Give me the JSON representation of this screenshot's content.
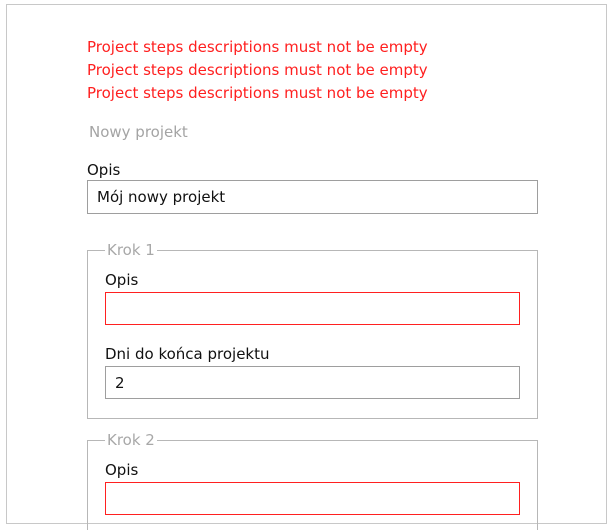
{
  "errors": [
    "Project steps descriptions must not be empty",
    "Project steps descriptions must not be empty",
    "Project steps descriptions must not be empty"
  ],
  "form": {
    "title": "Nowy projekt",
    "description_label": "Opis",
    "description_value": "Mój nowy projekt",
    "steps": [
      {
        "legend": "Krok 1",
        "description_label": "Opis",
        "description_value": "",
        "days_label": "Dni do końca projektu",
        "days_value": "2"
      },
      {
        "legend": "Krok 2",
        "description_label": "Opis",
        "description_value": ""
      }
    ]
  },
  "colors": {
    "error": "#ff1f1f",
    "muted": "#a4a4a4"
  }
}
